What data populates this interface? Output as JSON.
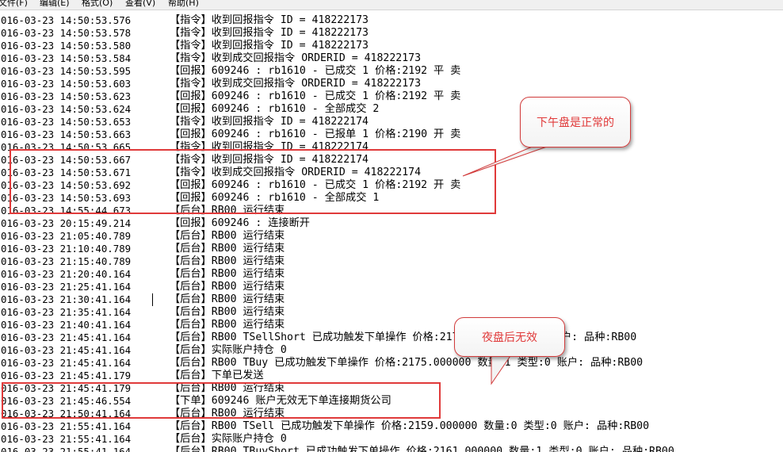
{
  "menu": [
    "文件(F)",
    "编辑(E)",
    "格式(O)",
    "查看(V)",
    "帮助(H)"
  ],
  "log_rows": [
    {
      "ts": "016-03-23 14:50:53.576",
      "msg": "【指令】收到回报指令 ID = 418222173"
    },
    {
      "ts": "016-03-23 14:50:53.578",
      "msg": "【指令】收到回报指令 ID = 418222173"
    },
    {
      "ts": "016-03-23 14:50:53.580",
      "msg": "【指令】收到回报指令 ID = 418222173"
    },
    {
      "ts": "016-03-23 14:50:53.584",
      "msg": "【指令】收到成交回报指令 ORDERID = 418222173"
    },
    {
      "ts": "016-03-23 14:50:53.595",
      "msg": "【回报】609246 : rb1610 - 已成交 1 价格:2192 平 卖"
    },
    {
      "ts": "016-03-23 14:50:53.603",
      "msg": "【指令】收到成交回报指令 ORDERID = 418222173"
    },
    {
      "ts": "016-03-23 14:50:53.623",
      "msg": "【回报】609246 : rb1610 - 已成交 1 价格:2192 平 卖"
    },
    {
      "ts": "016-03-23 14:50:53.624",
      "msg": "【回报】609246 : rb1610 - 全部成交 2"
    },
    {
      "ts": "016-03-23 14:50:53.653",
      "msg": "【指令】收到回报指令 ID = 418222174"
    },
    {
      "ts": "016-03-23 14:50:53.663",
      "msg": "【回报】609246 : rb1610 - 已报单 1 价格:2190 开 卖"
    },
    {
      "ts": "016-03-23 14:50:53.665",
      "msg": "【指令】收到回报指令 ID = 418222174"
    },
    {
      "ts": "016-03-23 14:50:53.667",
      "msg": "【指令】收到回报指令 ID = 418222174"
    },
    {
      "ts": "016-03-23 14:50:53.671",
      "msg": "【指令】收到成交回报指令 ORDERID = 418222174"
    },
    {
      "ts": "016-03-23 14:50:53.692",
      "msg": "【回报】609246 : rb1610 - 已成交 1 价格:2192 开 卖"
    },
    {
      "ts": "016-03-23 14:50:53.693",
      "msg": "【回报】609246 : rb1610 - 全部成交 1"
    },
    {
      "ts": "016-03-23 14:55:44.673",
      "msg": "【后台】RB00 运行结束"
    },
    {
      "ts": "016-03-23 20:15:49.214",
      "msg": "【回报】609246 : 连接断开"
    },
    {
      "ts": "016-03-23 21:05:40.789",
      "msg": "【后台】RB00 运行结束"
    },
    {
      "ts": "016-03-23 21:10:40.789",
      "msg": "【后台】RB00 运行结束"
    },
    {
      "ts": "016-03-23 21:15:40.789",
      "msg": "【后台】RB00 运行结束"
    },
    {
      "ts": "016-03-23 21:20:40.164",
      "msg": "【后台】RB00 运行结束"
    },
    {
      "ts": "016-03-23 21:25:41.164",
      "msg": "【后台】RB00 运行结束"
    },
    {
      "ts": "016-03-23 21:30:41.164",
      "msg": "【后台】RB00 运行结束"
    },
    {
      "ts": "016-03-23 21:35:41.164",
      "msg": "【后台】RB00 运行结束"
    },
    {
      "ts": "016-03-23 21:40:41.164",
      "msg": "【后台】RB00 运行结束"
    },
    {
      "ts": "016-03-23 21:45:41.164",
      "msg": "【后台】RB00 TSellShort 已成功触发下单操作 价格:2175 数量:0 类型:0 账户: 品种:RB00"
    },
    {
      "ts": "016-03-23 21:45:41.164",
      "msg": "【后台】实际账户持仓 0"
    },
    {
      "ts": "016-03-23 21:45:41.164",
      "msg": "【后台】RB00 TBuy 已成功触发下单操作 价格:2175.000000 数量:1 类型:0 账户: 品种:RB00"
    },
    {
      "ts": "016-03-23 21:45:41.179",
      "msg": "【后台】下单已发送"
    },
    {
      "ts": "016-03-23 21:45:41.179",
      "msg": "【后台】RB00 运行结束"
    },
    {
      "ts": "016-03-23 21:45:46.554",
      "msg": "【下单】609246 账户无效无下单连接期货公司"
    },
    {
      "ts": "016-03-23 21:50:41.164",
      "msg": "【后台】RB00 运行结束"
    },
    {
      "ts": "016-03-23 21:55:41.164",
      "msg": "【后台】RB00 TSell 已成功触发下单操作 价格:2159.000000 数量:0 类型:0 账户: 品种:RB00"
    },
    {
      "ts": "016-03-23 21:55:41.164",
      "msg": "【后台】实际账户持仓 0"
    },
    {
      "ts": "016-03-23 21:55:41.164",
      "msg": "【后台】RB00 TBuyShort 已成功触发下单操作 价格:2161.000000 数量:1 类型:0 账户: 品种:RB00"
    }
  ],
  "callouts": {
    "afternoon": "下午盘是正常的",
    "night": "夜盘后无效"
  },
  "colors": {
    "annotation_red": "#e03a3a"
  }
}
